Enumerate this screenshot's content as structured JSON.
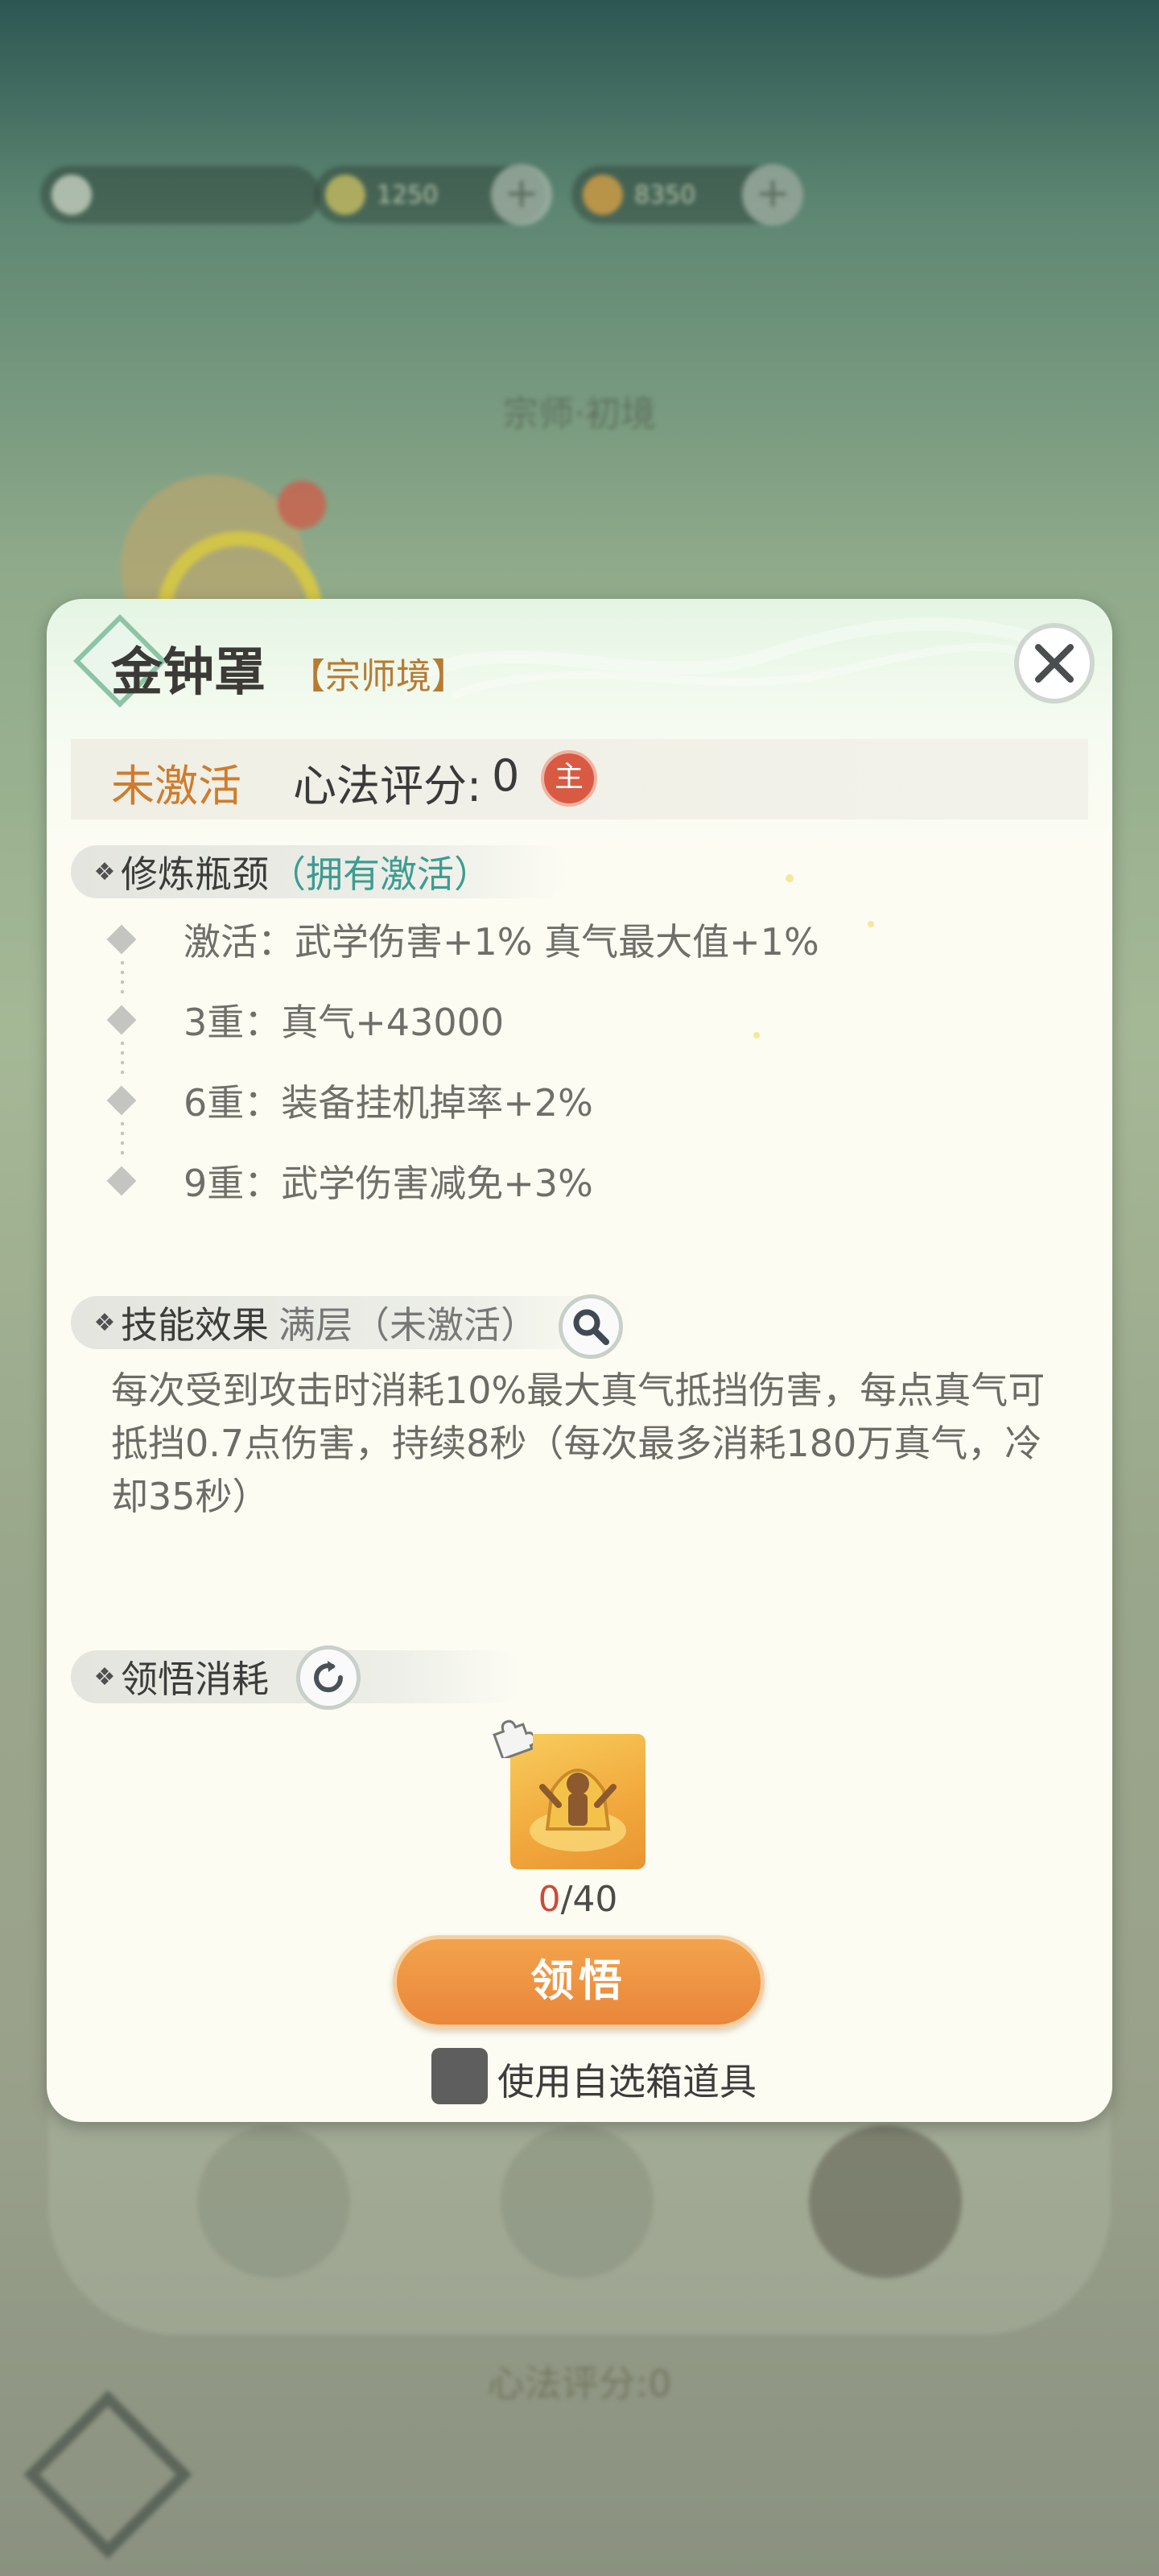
{
  "background": {
    "currency_1": "1250",
    "currency_2": "8350",
    "page_title": "宗师·初境",
    "skill_score": "心法评分:0"
  },
  "modal": {
    "title": "金钟罩",
    "rank": "【宗师境】",
    "status": "未激活",
    "score_label": "心法评分:",
    "score_value": "0",
    "main_badge": "主",
    "bottleneck": {
      "label": "修炼瓶颈",
      "hint": "（拥有激活）",
      "items": [
        "激活：武学伤害+1%  真气最大值+1%",
        "3重：真气+43000",
        "6重：装备挂机掉率+2%",
        "9重：武学伤害减免+3%"
      ]
    },
    "effect": {
      "label": "技能效果",
      "level": "满层（未激活）",
      "description": "每次受到攻击时消耗10%最大真气抵挡伤害，每点真气可抵挡0.7点伤害，持续8秒（每次最多消耗180万真气，冷却35秒）"
    },
    "cost": {
      "label": "领悟消耗",
      "owned": "0",
      "required": "/40",
      "button": "领悟",
      "checkbox_label": "使用自选箱道具"
    }
  },
  "colors": {
    "accent_orange": "#e9863a",
    "status_orange": "#d07c2c",
    "teal": "#3c9c92",
    "badge_red": "#d95a43"
  },
  "icons": {
    "close": "close-icon",
    "magnify": "search-icon",
    "refresh": "refresh-icon",
    "item": "golden-bell-statue-icon",
    "puzzle": "puzzle-piece-icon"
  }
}
